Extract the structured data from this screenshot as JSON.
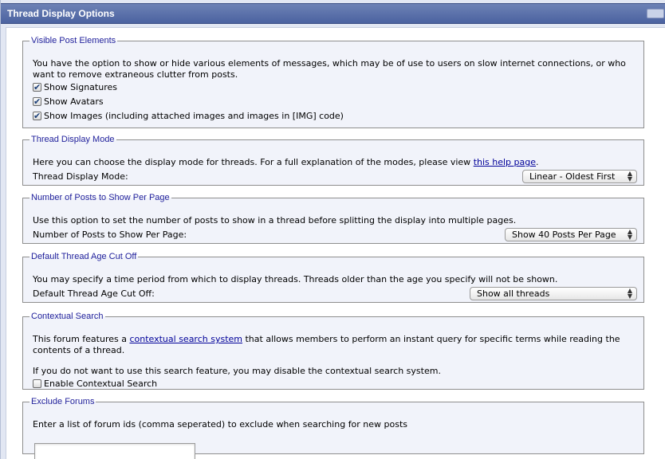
{
  "header": {
    "title": "Thread Display Options"
  },
  "visible_post_elements": {
    "legend": "Visible Post Elements",
    "description": "You have the option to show or hide various elements of messages, which may be of use to users on slow internet connections, or who want to remove extraneous clutter from posts.",
    "options": [
      {
        "label": "Show Signatures",
        "checked": true
      },
      {
        "label": "Show Avatars",
        "checked": true
      },
      {
        "label": "Show Images (including attached images and images in [IMG] code)",
        "checked": true
      }
    ]
  },
  "thread_display_mode": {
    "legend": "Thread Display Mode",
    "description_before_link": "Here you can choose the display mode for threads. For a full explanation of the modes, please view ",
    "link_text": "this help page",
    "description_after_link": ".",
    "label": "Thread Display Mode:",
    "selected": "Linear - Oldest First"
  },
  "posts_per_page": {
    "legend": "Number of Posts to Show Per Page",
    "description": "Use this option to set the number of posts to show in a thread before splitting the display into multiple pages.",
    "label": "Number of Posts to Show Per Page:",
    "selected": "Show 40 Posts Per Page"
  },
  "thread_age_cutoff": {
    "legend": "Default Thread Age Cut Off",
    "description": "You may specify a time period from which to display threads. Threads older than the age you specify will not be shown.",
    "label": "Default Thread Age Cut Off:",
    "selected": "Show all threads"
  },
  "contextual_search": {
    "legend": "Contextual Search",
    "description_before_link": "This forum features a ",
    "link_text": "contextual search system",
    "description_after_link": " that allows members to perform an instant query for specific terms while reading the contents of a thread.",
    "description2": "If you do not want to use this search feature, you may disable the contextual search system.",
    "option_label": "Enable Contextual Search",
    "option_checked": false
  },
  "exclude_forums": {
    "legend": "Exclude Forums",
    "description": "Enter a list of forum ids (comma seperated) to exclude when searching for new posts",
    "value": ""
  },
  "colors": {
    "header_bg": "#4b62a0",
    "panel_bg": "#e2e7f3",
    "fieldset_bg": "#f1f3fa",
    "legend_text": "#22229c",
    "link": "#000099"
  }
}
